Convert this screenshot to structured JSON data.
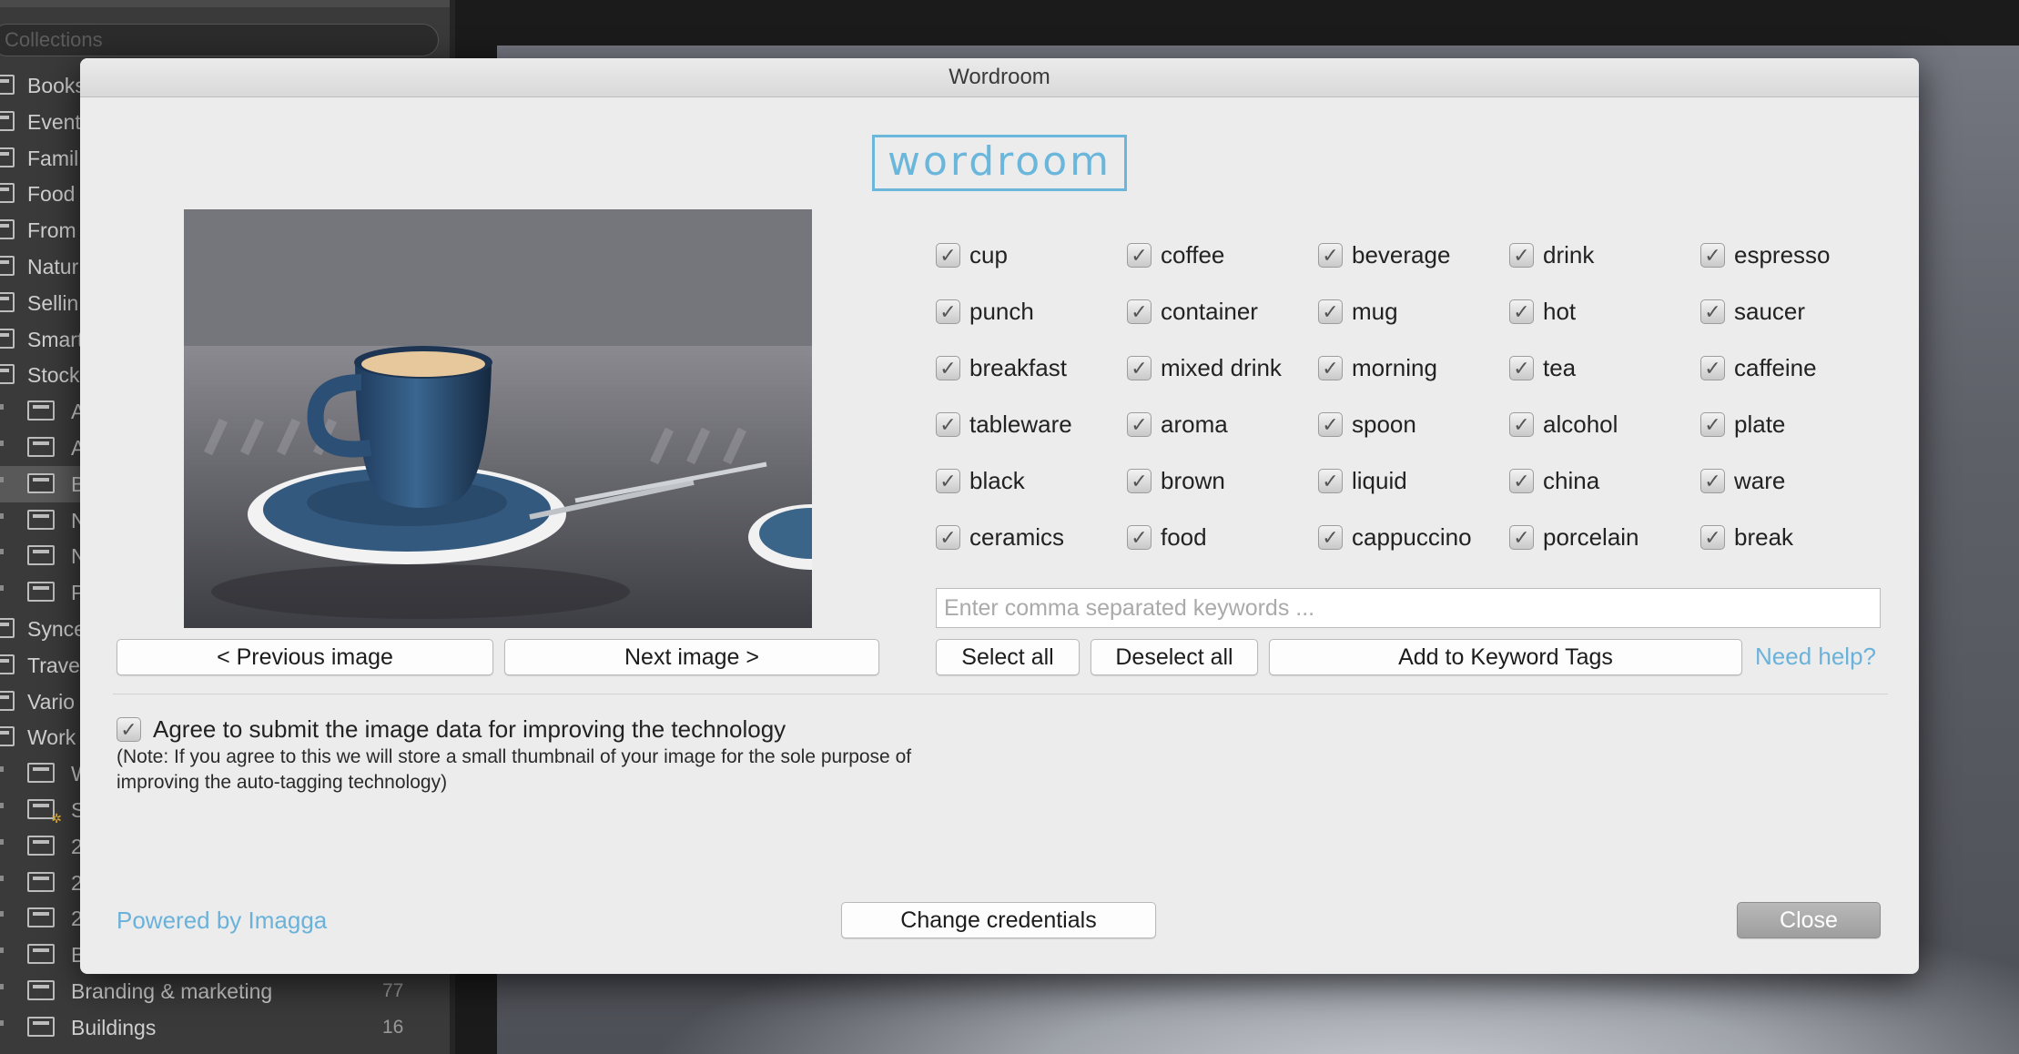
{
  "sidebar": {
    "search_placeholder": "Collections",
    "items": [
      {
        "label": "Books",
        "count": ""
      },
      {
        "label": "Event",
        "count": ""
      },
      {
        "label": "Famil",
        "count": ""
      },
      {
        "label": "Food",
        "count": ""
      },
      {
        "label": "From",
        "count": ""
      },
      {
        "label": "Natur",
        "count": ""
      },
      {
        "label": "Sellin",
        "count": ""
      },
      {
        "label": "Smart",
        "count": ""
      },
      {
        "label": "Stock",
        "count": ""
      },
      {
        "label": "A",
        "count": ""
      },
      {
        "label": "A",
        "count": ""
      },
      {
        "label": "B",
        "count": ""
      },
      {
        "label": "N",
        "count": ""
      },
      {
        "label": "N",
        "count": ""
      },
      {
        "label": "P",
        "count": ""
      },
      {
        "label": "Synce",
        "count": ""
      },
      {
        "label": "Trave",
        "count": ""
      },
      {
        "label": "Vario",
        "count": ""
      },
      {
        "label": "Work",
        "count": ""
      },
      {
        "label": "W",
        "count": ""
      },
      {
        "label": "S",
        "count": ""
      },
      {
        "label": "2",
        "count": ""
      },
      {
        "label": "2",
        "count": ""
      },
      {
        "label": "2",
        "count": ""
      },
      {
        "label": "B",
        "count": ""
      },
      {
        "label": "Branding & marketing",
        "count": "77"
      },
      {
        "label": "Buildings",
        "count": "16"
      }
    ]
  },
  "dialog": {
    "title": "Wordroom",
    "logo_text": "wordroom",
    "prev_button": "< Previous image",
    "next_button": "Next image >",
    "keywords": [
      "cup",
      "coffee",
      "beverage",
      "drink",
      "espresso",
      "punch",
      "container",
      "mug",
      "hot",
      "saucer",
      "breakfast",
      "mixed drink",
      "morning",
      "tea",
      "caffeine",
      "tableware",
      "aroma",
      "spoon",
      "alcohol",
      "plate",
      "black",
      "brown",
      "liquid",
      "china",
      "ware",
      "ceramics",
      "food",
      "cappuccino",
      "porcelain",
      "break"
    ],
    "checkmark_glyph": "✓",
    "keyword_input_placeholder": "Enter comma separated keywords ...",
    "keyword_input_value": "",
    "select_all": "Select all",
    "deselect_all": "Deselect all",
    "add_to_tags": "Add to Keyword Tags",
    "need_help": "Need help?",
    "agree_label": "Agree to submit the image data for improving the technology",
    "agree_note": "(Note: If you agree to this we will store a small thumbnail of your image for the sole purpose of improving the auto-tagging technology)",
    "powered_by": "Powered by Imagga",
    "change_credentials": "Change credentials",
    "close": "Close"
  },
  "colors": {
    "link": "#6ab2da",
    "logo": "#6bb7dc",
    "dialog_bg": "#ececec",
    "sidebar_bg": "#3a3a3a"
  }
}
